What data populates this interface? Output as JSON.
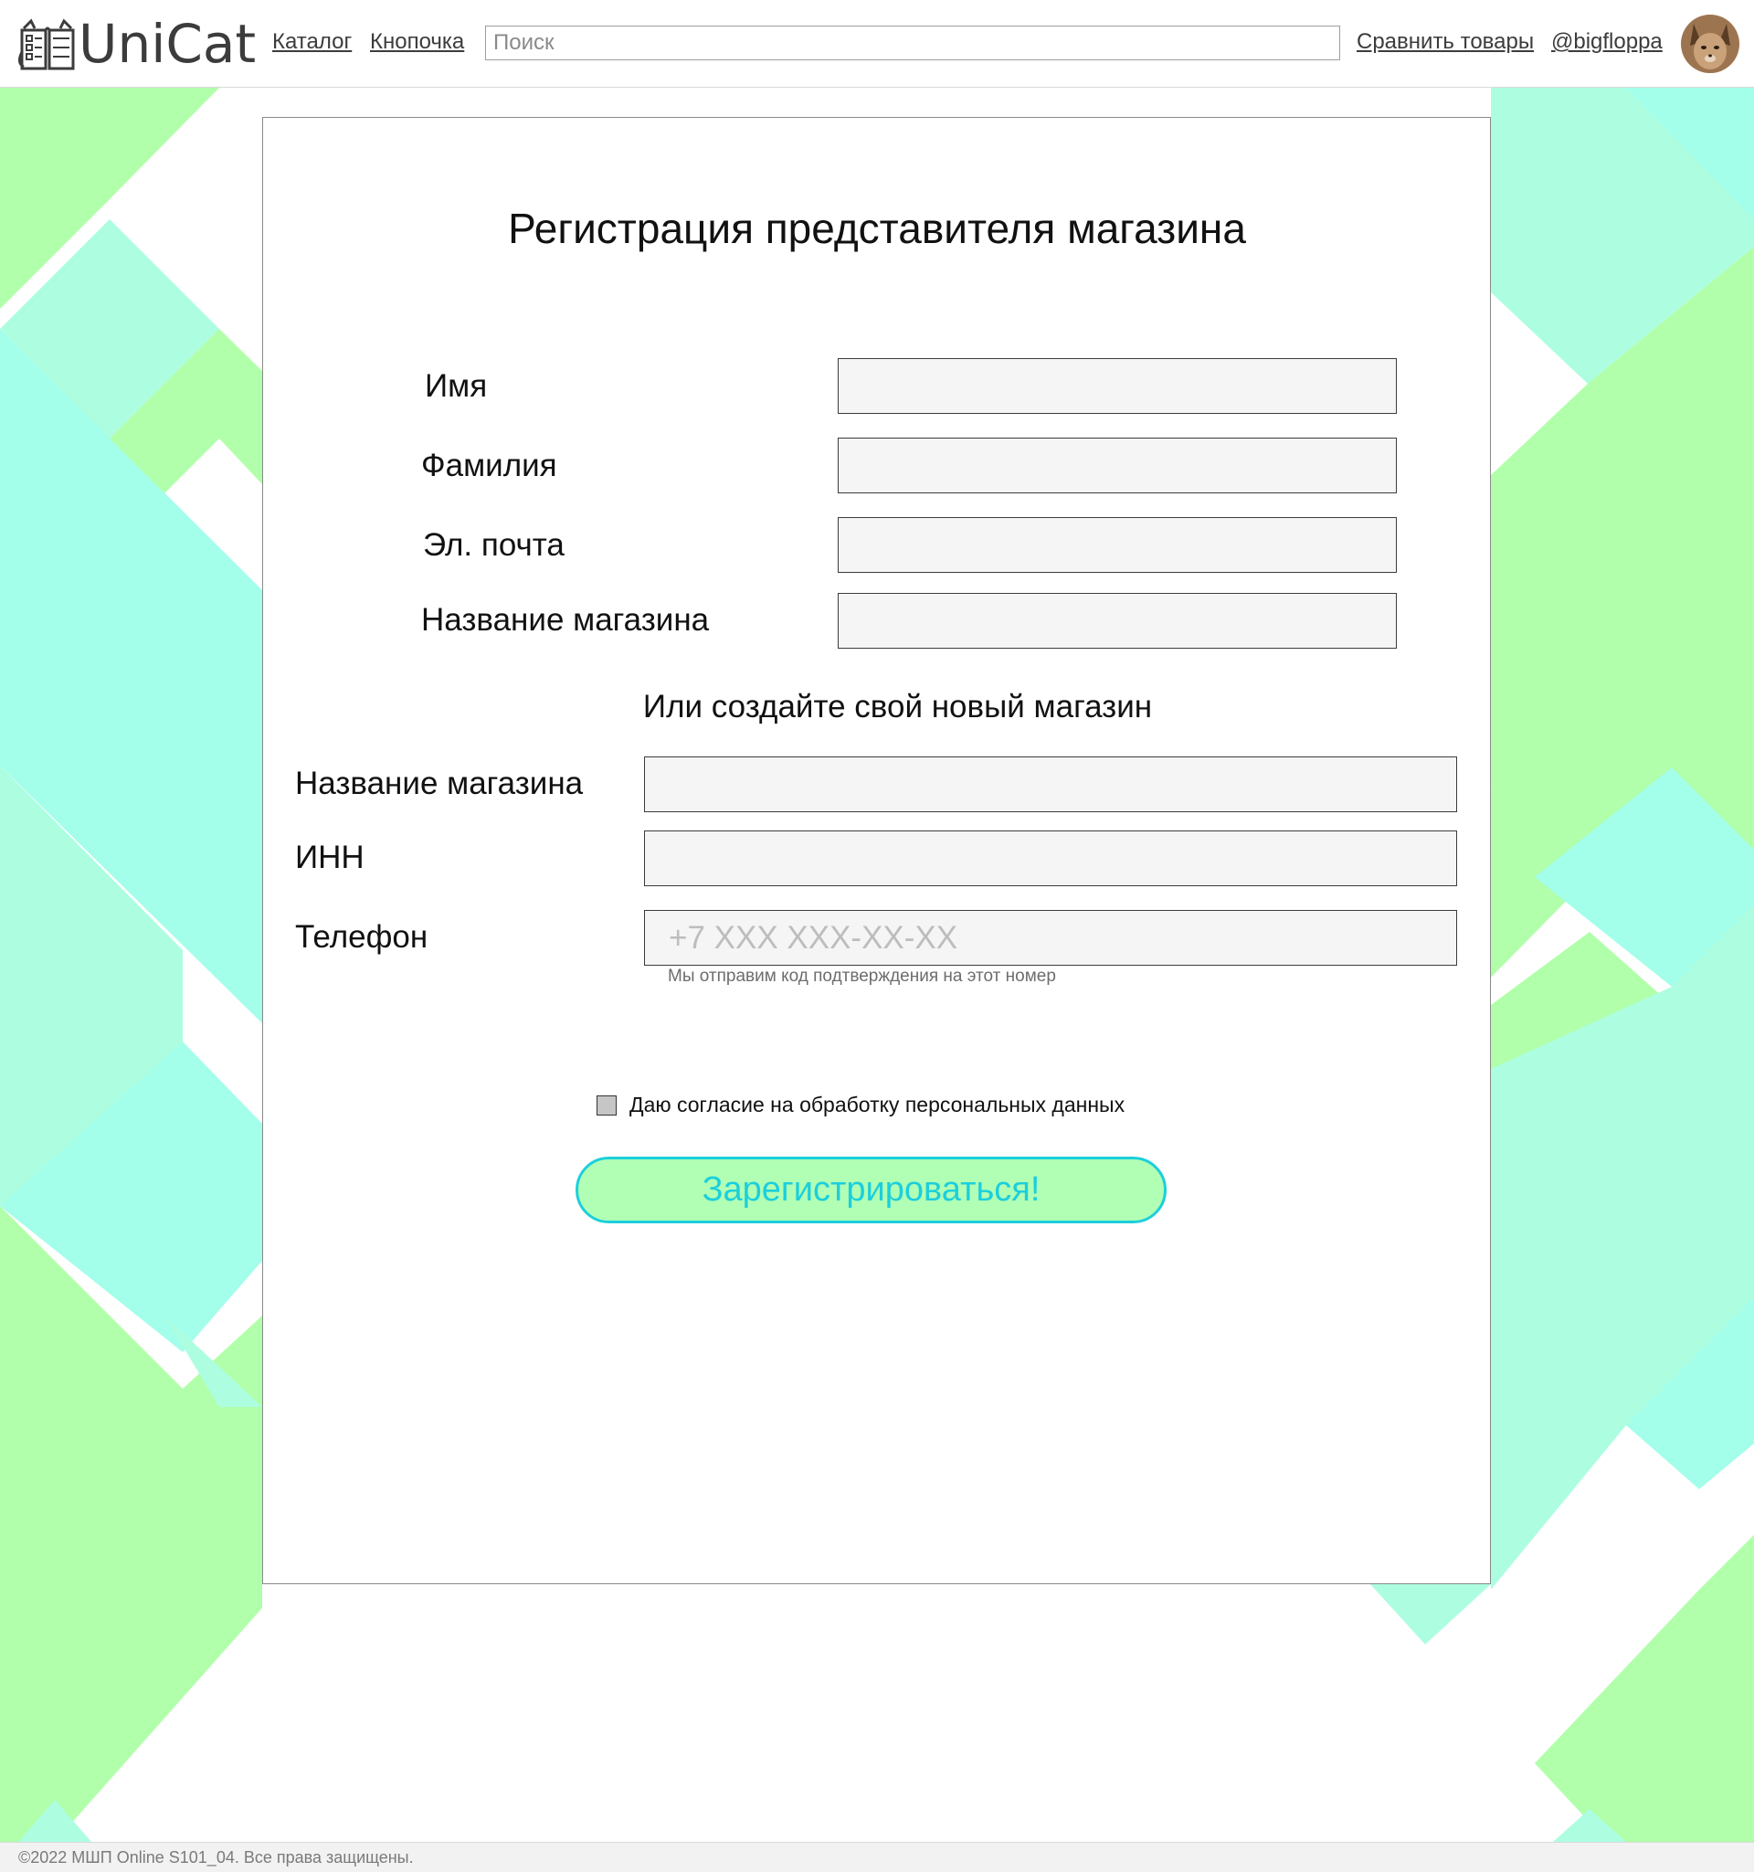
{
  "header": {
    "logo_text": "UniCat",
    "nav": {
      "catalog": "Каталог",
      "button": "Кнопочка"
    },
    "search": {
      "placeholder": "Поиск",
      "value": ""
    },
    "compare": "Сравнить товары",
    "user": "@bigfloppa",
    "avatar_icon": "cat-avatar-icon"
  },
  "form": {
    "title": "Регистрация представителя магазина",
    "fields": {
      "first_name": {
        "label": "Имя",
        "value": ""
      },
      "last_name": {
        "label": "Фамилия",
        "value": ""
      },
      "email": {
        "label": "Эл. почта",
        "value": ""
      },
      "shop_name": {
        "label": "Название магазина",
        "value": ""
      }
    },
    "new_shop": {
      "subtitle": "Или создайте свой новый магазин",
      "shop_name": {
        "label": "Название магазина",
        "value": ""
      },
      "inn": {
        "label": "ИНН",
        "value": ""
      },
      "phone": {
        "label": "Телефон",
        "placeholder": "+7 XXX XXX-XX-XX",
        "value": "",
        "hint": "Мы отправим код подтверждения на этот номер"
      }
    },
    "consent": {
      "label": "Даю согласие на обработку персональных данных",
      "checked": false
    },
    "submit_label": "Зарегистрироваться!"
  },
  "footer": {
    "text": "©2022 МШП Online S101_04. Все права защищены."
  },
  "colors": {
    "bg_green": "#b1ffaa",
    "bg_mint": "#adfee0",
    "bg_cyan": "#a3feea",
    "button_fill": "#b1ffb5",
    "button_accent": "#1ccfdb"
  }
}
